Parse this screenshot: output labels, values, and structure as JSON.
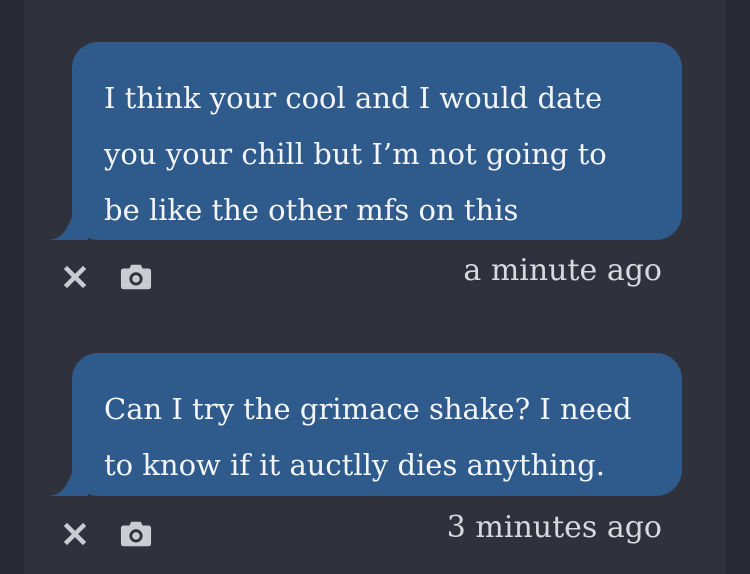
{
  "messages": [
    {
      "text": "I think your cool and I would date you your chill but I’m not going to be like the other mfs on this",
      "timestamp": "a minute ago",
      "dismiss_icon": "close-icon",
      "media_icon": "camera-icon"
    },
    {
      "text": "Can I try the grimace shake? I need to know if it auctlly dies anything.",
      "timestamp": "3 minutes ago",
      "dismiss_icon": "close-icon",
      "media_icon": "camera-icon"
    }
  ],
  "colors": {
    "background": "#272a33",
    "panel": "#2f323c",
    "bubble": "#2f5a8c",
    "bubble_text": "#f3f5f8",
    "meta_text": "#d7d9df",
    "icon": "#c9ccd2"
  }
}
